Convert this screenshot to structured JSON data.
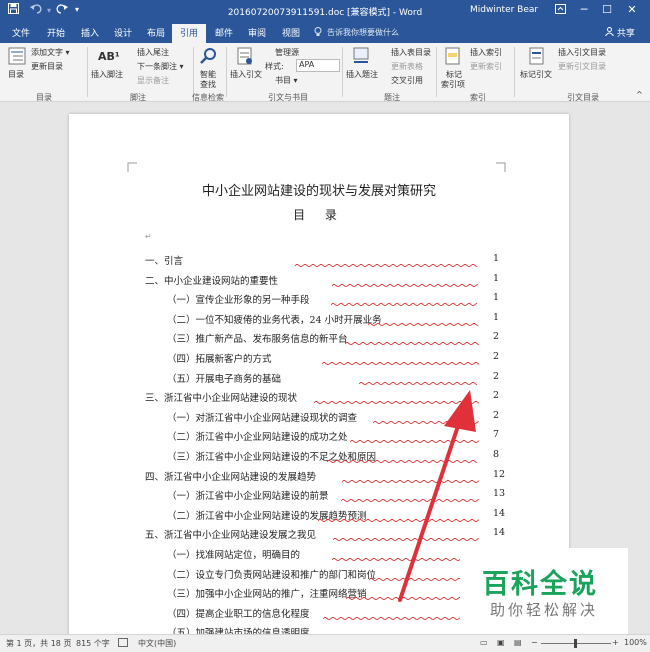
{
  "titlebar": {
    "doc_title": "20160720073911591.doc [兼容模式] - Word",
    "user": "Midwinter Bear",
    "save_icon": "save-icon",
    "undo_icon": "undo-icon",
    "redo_icon": "redo-icon",
    "customize_icon": "customize-quick-access-icon",
    "ribbon_options_icon": "ribbon-display-options-icon",
    "minimize": "─",
    "restore": "☐",
    "close": "✕"
  },
  "tabs": {
    "file": "文件",
    "home": "开始",
    "insert": "插入",
    "design": "设计",
    "layout": "布局",
    "references": "引用",
    "mailings": "邮件",
    "review": "审阅",
    "view": "视图",
    "tell_me": "告诉我你想要做什么",
    "share": "共享"
  },
  "ribbon": {
    "toc": "目录",
    "add_text": "添加文字 ▾",
    "update_toc": "更新目录",
    "insert_footnote": "插入脚注",
    "insert_endnote": "插入尾注",
    "next_footnote": "下一条脚注 ▾",
    "show_notes": "显示备注",
    "ab_label": "AB¹",
    "smart_lookup_1": "智能",
    "smart_lookup_2": "查找",
    "insert_citation": "插入引文",
    "manage_sources": "管理源",
    "style_label": "样式:",
    "style_value": "APA",
    "bibliography": "书目 ▾",
    "insert_caption": "插入题注",
    "insert_table_of_figures": "插入表目录",
    "update_table": "更新表格",
    "cross_reference": "交叉引用",
    "mark_entry_1": "标记",
    "mark_entry_2": "索引项",
    "insert_index": "插入索引",
    "update_index": "更新索引",
    "mark_citation": "标记引文",
    "insert_table_of_authorities": "插入引文目录",
    "update_table_auth": "更新引文目录",
    "groups": {
      "toc": "目录",
      "footnotes": "脚注",
      "research": "信息检索",
      "citations": "引文与书目",
      "captions": "题注",
      "index": "索引",
      "authorities": "引文目录"
    }
  },
  "document": {
    "title": "中小企业网站建设的现状与发展对策研究",
    "subtitle": "目 录",
    "toc": [
      {
        "text": "一、引言",
        "page": "1",
        "level": 1
      },
      {
        "text": "二、中小企业建设网站的重要性",
        "page": "1",
        "level": 1
      },
      {
        "text": "（一）宣传企业形象的另一种手段",
        "page": "1",
        "level": 2
      },
      {
        "text": "（二）一位不知疲倦的业务代表，24 小时开展业务",
        "page": "1",
        "level": 2
      },
      {
        "text": "（三）推广新产品、发布服务信息的新平台",
        "page": "2",
        "level": 2
      },
      {
        "text": "（四）拓展新客户的方式",
        "page": "2",
        "level": 2
      },
      {
        "text": "（五）开展电子商务的基础",
        "page": "2",
        "level": 2
      },
      {
        "text": "三、浙江省中小企业网站建设的现状",
        "page": "2",
        "level": 1
      },
      {
        "text": "（一）对浙江省中小企业网站建设现状的调查",
        "page": "2",
        "level": 2
      },
      {
        "text": "（二）浙江省中小企业网站建设的成功之处",
        "page": "7",
        "level": 2
      },
      {
        "text": "（三）浙江省中小企业网站建设的不足之处和原因",
        "page": "8",
        "level": 2
      },
      {
        "text": "四、浙江省中小企业网站建设的发展趋势",
        "page": "12",
        "level": 1
      },
      {
        "text": "（一）浙江省中小企业网站建设的前景",
        "page": "13",
        "level": 2
      },
      {
        "text": "（二）浙江省中小企业网站建设的发展趋势预测",
        "page": "14",
        "level": 2
      },
      {
        "text": "五、浙江省中小企业网站建设发展之我见",
        "page": "14",
        "level": 1
      },
      {
        "text": "（一）找准网站定位，明确目的",
        "page": "",
        "level": 2
      },
      {
        "text": "（二）设立专门负责网站建设和推广的部门和岗位",
        "page": "",
        "level": 2
      },
      {
        "text": "（三）加强中小企业网站的推广，注重网络营销",
        "page": "",
        "level": 2
      },
      {
        "text": "（四）提高企业职工的信息化程度",
        "page": "",
        "level": 2
      },
      {
        "text": "（五）加强建站市场的信息透明度",
        "page": "16",
        "level": 2
      }
    ]
  },
  "status": {
    "page": "第 1 页，共 18 页",
    "words": "815 个字",
    "language": "中文(中国)",
    "zoom": "100%"
  },
  "watermark": {
    "title": "百科全说",
    "subtitle": "助你轻松解决"
  },
  "colors": {
    "accent": "#2b579a",
    "arrow": "#e0303a",
    "watermark": "#1aa35a"
  }
}
